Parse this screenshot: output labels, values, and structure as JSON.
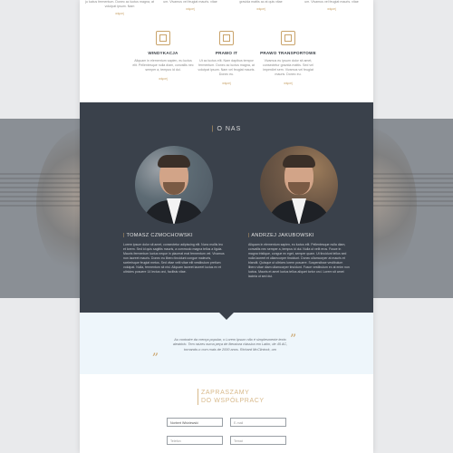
{
  "top_services": [
    {
      "text": "ju luctus fermentum. Donec ac luctus magna, at volutpat ipsum. Nam",
      "more": "więcej"
    },
    {
      "text": "um. Vivamus vel feugiat mauris. vitae",
      "more": "więcej"
    },
    {
      "text": "gravida mattis ac at quis vitae",
      "more": "więcej"
    },
    {
      "text": "um. Vivamus vel feugiat mauris. vitae",
      "more": "więcej"
    }
  ],
  "services": [
    {
      "icon": "document-icon",
      "title": "WINDYKACJA",
      "desc": "Aliquam in elementum sapien, eu luctus elit. Pellentesque nulla diam, convallis nec semper a, tempus id dui.",
      "more": "więcej"
    },
    {
      "icon": "computer-document-icon",
      "title": "PRAWO IT",
      "desc": "Ut ac luctus elit. Nam dapibus tempor fermentum. Donec ac luctus magna, at volutpat ipsum. Nam vel feugiat mauris. Donec eu.",
      "more": "więcej"
    },
    {
      "icon": "truck-icon",
      "title": "PRAWO TRANSPORTOWE",
      "desc": "Vivamus eu ipsum dolor sit amet, consectetur gravida mattis. Sed vel imperdiet sem. Vivamus vel feugiat mauris. Donec eu.",
      "more": "więcej"
    }
  ],
  "about": {
    "heading": "O NAS",
    "people": [
      {
        "name": "TOMASZ CZMOCHOWSKI",
        "bio": "Lorem ipsum dolor sit amet, consectetur adipiscing elit. Nunc mollis leo et lorem. Sed id quis sagittis mauris, a commodo magna tellus a ligula. Mauris fermentum luctus neque in placerat erat fermentum vel. Vivamus non laoreet mauris. Donec eu libero tincidunt congue maleuris, scelerisque feugiat metus. Sed vitae velit vitae elit vestibulum pretium volutpat. Nulla, fermentum sit nisl. Aliquam laoreet laoreet luctus ex et ultricies posuere 14 lectus orci, facilisis vitae."
      },
      {
        "name": "ANDRZEJ JAKUBOWSKI",
        "bio": "Aliquam in elementum sapien, eu luctus elit. Pellentesque nulla diam, convallis nec semper a, tempus id dui. Nulla ut velit eros. Fusce in magna tristique, congue ex eget, semper quam. Ut tincidunt tellus sed nulla laoreet et ullamcorper tincidunt. Donec ullamcorper at mauris et blandit. Quisque ut ultrices lorem posuere. Suspendisse vestibulum libero vitae diam ullamcorper tincidunt. Fusce vestibulum ex at enim non luctus. Mauris et amet luctus tellus aliquet tortor orci. Lorem sit amet lacinia ut sed dui."
      }
    ]
  },
  "quote": {
    "open": "„",
    "close": "”",
    "text": "Au contraire da crença popular, o Lorem Ipsum não é simplesmente texto aleatório. Tem raízes numa peça de literatura clássica em Latim, de 45 AC, tornando-o com mais de 2000 anos. Richard McClintock, um"
  },
  "contact": {
    "heading_line1": "ZAPRASZAMY",
    "heading_line2": "DO WSPÓŁPRACY",
    "fields": [
      {
        "value": "Norbert Wiśniewski",
        "placeholder": ""
      },
      {
        "value": "",
        "placeholder": "E-mail"
      },
      {
        "value": "",
        "placeholder": "Telefon"
      },
      {
        "value": "",
        "placeholder": "Temat"
      }
    ]
  },
  "colors": {
    "accent": "#c9a36a",
    "dark_section": "#3a414b",
    "quote_bg": "#eef6fb"
  }
}
